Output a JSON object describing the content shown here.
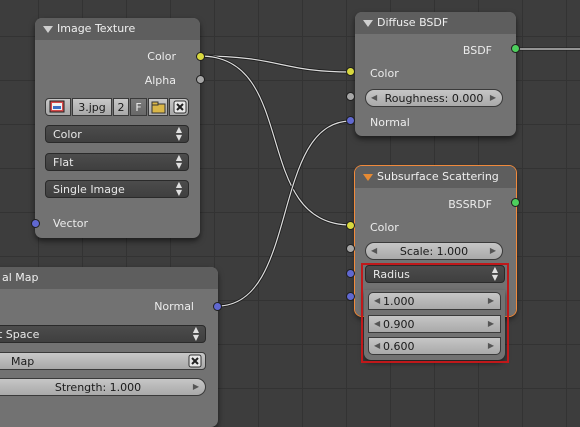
{
  "image_texture": {
    "title": "Image Texture",
    "out_color": "Color",
    "out_alpha": "Alpha",
    "image_name": "3.jpg",
    "users": "2",
    "fake_user": "F",
    "color_space": "Color",
    "projection": "Flat",
    "source": "Single Image",
    "in_vector": "Vector"
  },
  "diffuse": {
    "title": "Diffuse BSDF",
    "out_bsdf": "BSDF",
    "in_color": "Color",
    "roughness": "Roughness: 0.000",
    "in_normal": "Normal"
  },
  "sss": {
    "title": "Subsurface Scattering",
    "out_bssrdf": "BSSRDF",
    "in_color": "Color",
    "scale": "Scale: 1.000",
    "radius_label": "Radius",
    "radius": [
      "1.000",
      "0.900",
      "0.600"
    ]
  },
  "normal_map": {
    "title_partial": "al Map",
    "out_normal": "Normal",
    "space_partial": "t Space",
    "uv_partial": "Map",
    "strength": "Strength: 1.000"
  },
  "colors": {
    "socket_color": "#d8d83e",
    "socket_value": "#a6a6a6",
    "socket_vector": "#6068d0",
    "socket_shader": "#4dcf5d",
    "selection_outline": "#f08a3c",
    "highlight_box": "#c0181a"
  }
}
